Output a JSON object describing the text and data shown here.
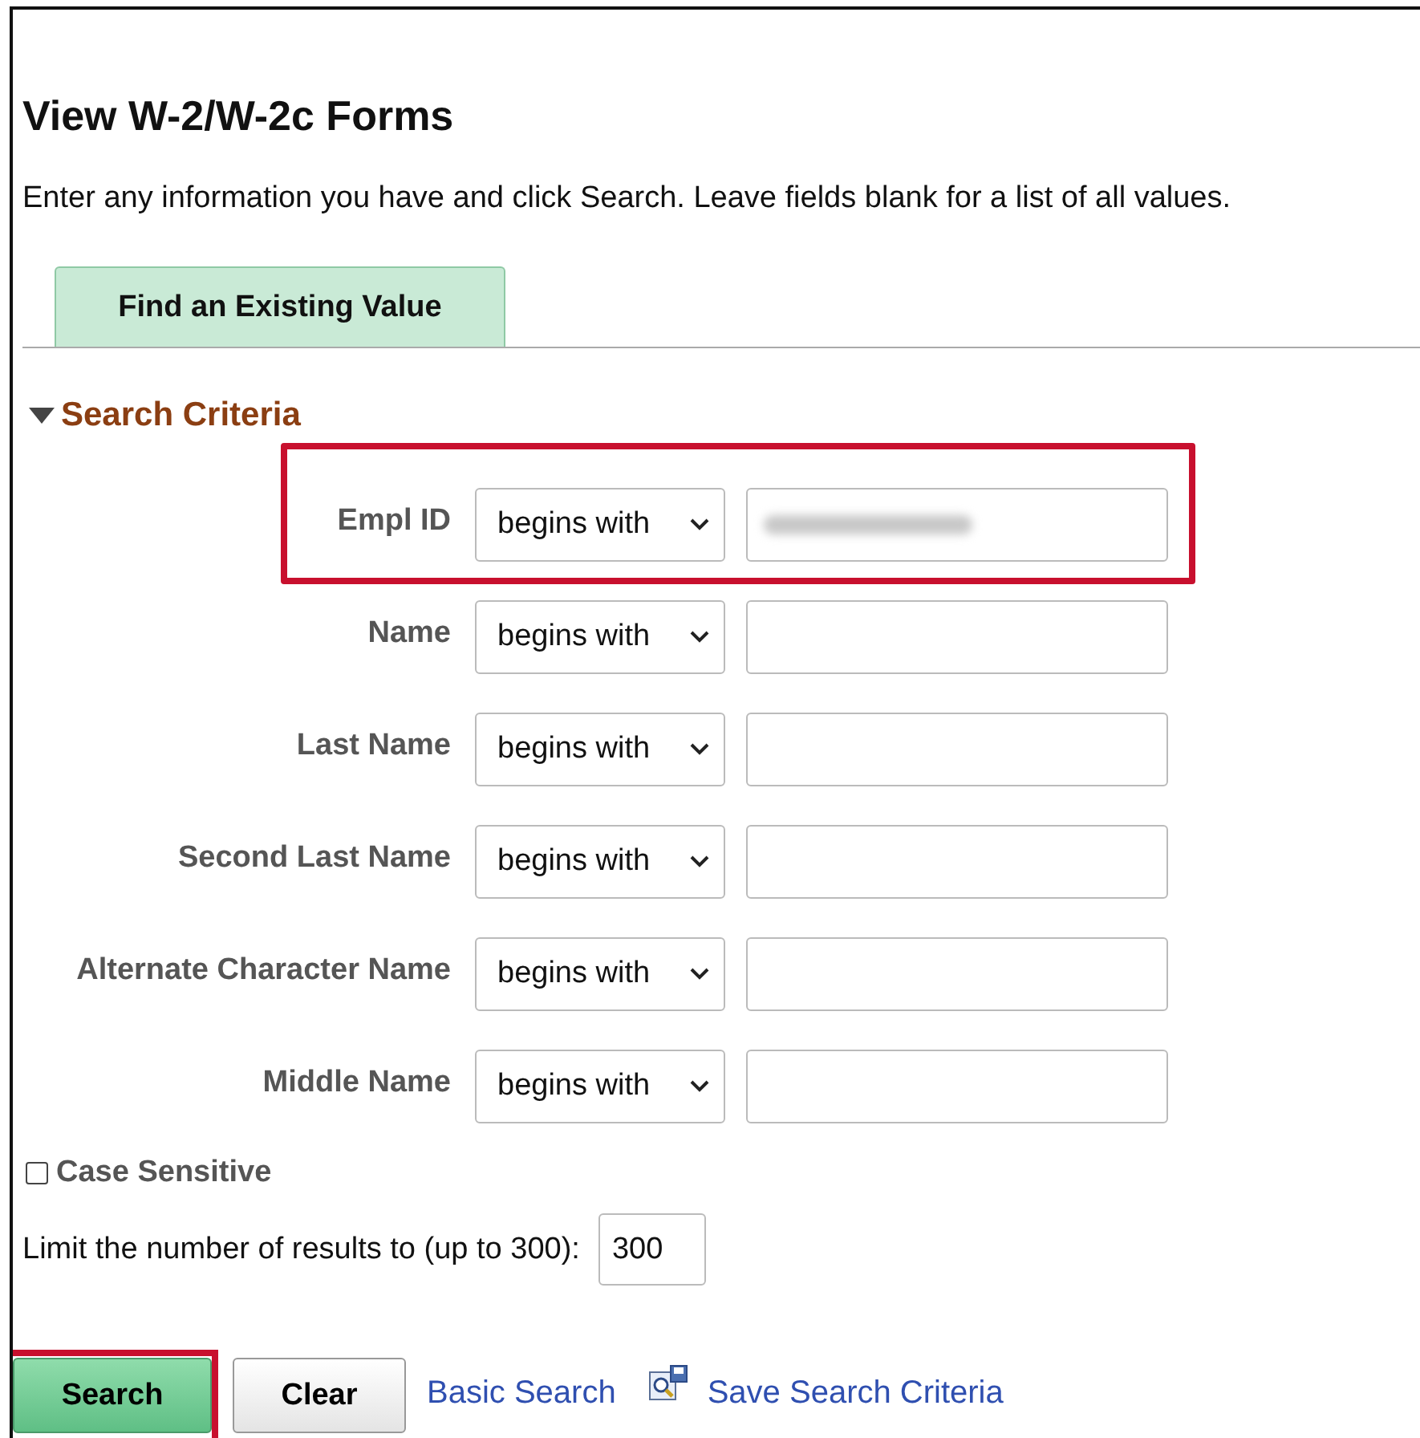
{
  "page": {
    "title": "View W-2/W-2c Forms",
    "instructions": "Enter any information you have and click Search. Leave fields blank for a list of all values."
  },
  "tabs": [
    {
      "label": "Find an Existing Value",
      "selected": true
    }
  ],
  "section": {
    "title": "Search Criteria",
    "expanded": true
  },
  "fields": [
    {
      "label": "Empl ID",
      "operator": "begins with",
      "value_blurred": true,
      "highlighted": true
    },
    {
      "label": "Name",
      "operator": "begins with",
      "value_blurred": false,
      "highlighted": false
    },
    {
      "label": "Last Name",
      "operator": "begins with",
      "value_blurred": false,
      "highlighted": false
    },
    {
      "label": "Second Last Name",
      "operator": "begins with",
      "value_blurred": false,
      "highlighted": false
    },
    {
      "label": "Alternate Character Name",
      "operator": "begins with",
      "value_blurred": false,
      "highlighted": false
    },
    {
      "label": "Middle Name",
      "operator": "begins with",
      "value_blurred": false,
      "highlighted": false
    }
  ],
  "case_sensitive": {
    "label": "Case Sensitive",
    "checked": false
  },
  "limit": {
    "label": "Limit the number of results to (up to 300):",
    "value": "300"
  },
  "buttons": [
    {
      "label": "Search",
      "kind": "primary",
      "highlighted": true
    },
    {
      "label": "Clear",
      "kind": "secondary",
      "highlighted": false
    }
  ],
  "links": [
    {
      "label": "Basic Search",
      "icon": false
    },
    {
      "label": "Save Search Criteria",
      "icon": true
    }
  ]
}
